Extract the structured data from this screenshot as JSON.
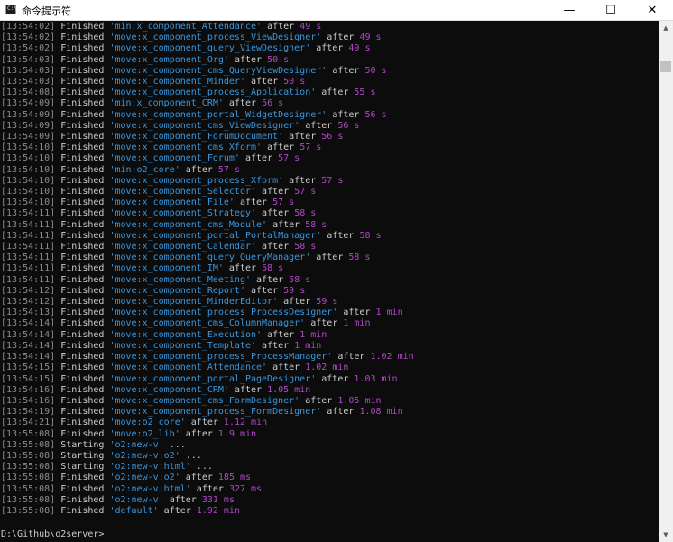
{
  "window": {
    "title": "命令提示符",
    "icon_label": "C:\\",
    "minimize_glyph": "—",
    "maximize_glyph": "☐",
    "close_glyph": "✕"
  },
  "colors": {
    "background": "#0c0c0c",
    "text": "#cccccc",
    "task": "#3a96dd",
    "duration": "#b148c6",
    "timestamp": "#8c8c8c"
  },
  "log_lines": [
    {
      "time": "[13:54:02]",
      "status": "Finished",
      "task": "'min:x_component_Attendance'",
      "after": "after",
      "duration": "49 s"
    },
    {
      "time": "[13:54:02]",
      "status": "Finished",
      "task": "'move:x_component_process_ViewDesigner'",
      "after": "after",
      "duration": "49 s"
    },
    {
      "time": "[13:54:02]",
      "status": "Finished",
      "task": "'move:x_component_query_ViewDesigner'",
      "after": "after",
      "duration": "49 s"
    },
    {
      "time": "[13:54:03]",
      "status": "Finished",
      "task": "'move:x_component_Org'",
      "after": "after",
      "duration": "50 s"
    },
    {
      "time": "[13:54:03]",
      "status": "Finished",
      "task": "'move:x_component_cms_QueryViewDesigner'",
      "after": "after",
      "duration": "50 s"
    },
    {
      "time": "[13:54:03]",
      "status": "Finished",
      "task": "'move:x_component_Minder'",
      "after": "after",
      "duration": "50 s"
    },
    {
      "time": "[13:54:08]",
      "status": "Finished",
      "task": "'move:x_component_process_Application'",
      "after": "after",
      "duration": "55 s"
    },
    {
      "time": "[13:54:09]",
      "status": "Finished",
      "task": "'min:x_component_CRM'",
      "after": "after",
      "duration": "56 s"
    },
    {
      "time": "[13:54:09]",
      "status": "Finished",
      "task": "'move:x_component_portal_WidgetDesigner'",
      "after": "after",
      "duration": "56 s"
    },
    {
      "time": "[13:54:09]",
      "status": "Finished",
      "task": "'move:x_component_cms_ViewDesigner'",
      "after": "after",
      "duration": "56 s"
    },
    {
      "time": "[13:54:09]",
      "status": "Finished",
      "task": "'move:x_component_ForumDocument'",
      "after": "after",
      "duration": "56 s"
    },
    {
      "time": "[13:54:10]",
      "status": "Finished",
      "task": "'move:x_component_cms_Xform'",
      "after": "after",
      "duration": "57 s"
    },
    {
      "time": "[13:54:10]",
      "status": "Finished",
      "task": "'move:x_component_Forum'",
      "after": "after",
      "duration": "57 s"
    },
    {
      "time": "[13:54:10]",
      "status": "Finished",
      "task": "'min:o2_core'",
      "after": "after",
      "duration": "57 s"
    },
    {
      "time": "[13:54:10]",
      "status": "Finished",
      "task": "'move:x_component_process_Xform'",
      "after": "after",
      "duration": "57 s"
    },
    {
      "time": "[13:54:10]",
      "status": "Finished",
      "task": "'move:x_component_Selector'",
      "after": "after",
      "duration": "57 s"
    },
    {
      "time": "[13:54:10]",
      "status": "Finished",
      "task": "'move:x_component_File'",
      "after": "after",
      "duration": "57 s"
    },
    {
      "time": "[13:54:11]",
      "status": "Finished",
      "task": "'move:x_component_Strategy'",
      "after": "after",
      "duration": "58 s"
    },
    {
      "time": "[13:54:11]",
      "status": "Finished",
      "task": "'move:x_component_cms_Module'",
      "after": "after",
      "duration": "58 s"
    },
    {
      "time": "[13:54:11]",
      "status": "Finished",
      "task": "'move:x_component_portal_PortalManager'",
      "after": "after",
      "duration": "58 s"
    },
    {
      "time": "[13:54:11]",
      "status": "Finished",
      "task": "'move:x_component_Calendar'",
      "after": "after",
      "duration": "58 s"
    },
    {
      "time": "[13:54:11]",
      "status": "Finished",
      "task": "'move:x_component_query_QueryManager'",
      "after": "after",
      "duration": "58 s"
    },
    {
      "time": "[13:54:11]",
      "status": "Finished",
      "task": "'move:x_component_IM'",
      "after": "after",
      "duration": "58 s"
    },
    {
      "time": "[13:54:11]",
      "status": "Finished",
      "task": "'move:x_component_Meeting'",
      "after": "after",
      "duration": "58 s"
    },
    {
      "time": "[13:54:12]",
      "status": "Finished",
      "task": "'move:x_component_Report'",
      "after": "after",
      "duration": "59 s"
    },
    {
      "time": "[13:54:12]",
      "status": "Finished",
      "task": "'move:x_component_MinderEditor'",
      "after": "after",
      "duration": "59 s"
    },
    {
      "time": "[13:54:13]",
      "status": "Finished",
      "task": "'move:x_component_process_ProcessDesigner'",
      "after": "after",
      "duration": "1 min"
    },
    {
      "time": "[13:54:14]",
      "status": "Finished",
      "task": "'move:x_component_cms_ColumnManager'",
      "after": "after",
      "duration": "1 min"
    },
    {
      "time": "[13:54:14]",
      "status": "Finished",
      "task": "'move:x_component_Execution'",
      "after": "after",
      "duration": "1 min"
    },
    {
      "time": "[13:54:14]",
      "status": "Finished",
      "task": "'move:x_component_Template'",
      "after": "after",
      "duration": "1 min"
    },
    {
      "time": "[13:54:14]",
      "status": "Finished",
      "task": "'move:x_component_process_ProcessManager'",
      "after": "after",
      "duration": "1.02 min"
    },
    {
      "time": "[13:54:15]",
      "status": "Finished",
      "task": "'move:x_component_Attendance'",
      "after": "after",
      "duration": "1.02 min"
    },
    {
      "time": "[13:54:15]",
      "status": "Finished",
      "task": "'move:x_component_portal_PageDesigner'",
      "after": "after",
      "duration": "1.03 min"
    },
    {
      "time": "[13:54:16]",
      "status": "Finished",
      "task": "'move:x_component_CRM'",
      "after": "after",
      "duration": "1.05 min"
    },
    {
      "time": "[13:54:16]",
      "status": "Finished",
      "task": "'move:x_component_cms_FormDesigner'",
      "after": "after",
      "duration": "1.05 min"
    },
    {
      "time": "[13:54:19]",
      "status": "Finished",
      "task": "'move:x_component_process_FormDesigner'",
      "after": "after",
      "duration": "1.08 min"
    },
    {
      "time": "[13:54:21]",
      "status": "Finished",
      "task": "'move:o2_core'",
      "after": "after",
      "duration": "1.12 min"
    },
    {
      "time": "[13:55:08]",
      "status": "Finished",
      "task": "'move:o2_lib'",
      "after": "after",
      "duration": "1.9 min"
    },
    {
      "time": "[13:55:08]",
      "status": "Starting",
      "task": "'o2:new-v'",
      "after": "...",
      "duration": ""
    },
    {
      "time": "[13:55:08]",
      "status": "Starting",
      "task": "'o2:new-v:o2'",
      "after": "...",
      "duration": ""
    },
    {
      "time": "[13:55:08]",
      "status": "Starting",
      "task": "'o2:new-v:html'",
      "after": "...",
      "duration": ""
    },
    {
      "time": "[13:55:08]",
      "status": "Finished",
      "task": "'o2:new-v:o2'",
      "after": "after",
      "duration": "185 ms"
    },
    {
      "time": "[13:55:08]",
      "status": "Finished",
      "task": "'o2:new-v:html'",
      "after": "after",
      "duration": "327 ms"
    },
    {
      "time": "[13:55:08]",
      "status": "Finished",
      "task": "'o2:new-v'",
      "after": "after",
      "duration": "331 ms"
    },
    {
      "time": "[13:55:08]",
      "status": "Finished",
      "task": "'default'",
      "after": "after",
      "duration": "1.92 min"
    }
  ],
  "prompt": "D:\\Github\\o2server>",
  "scrollbar": {
    "up_glyph": "▲",
    "down_glyph": "▼"
  }
}
